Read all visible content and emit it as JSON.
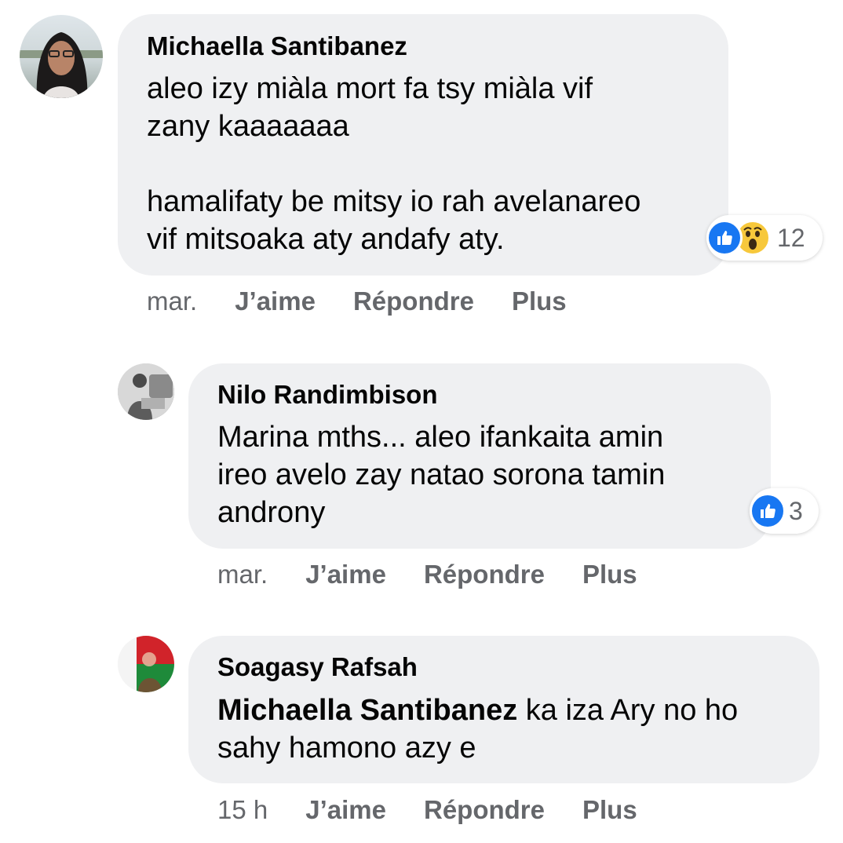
{
  "comments": [
    {
      "author": "Michaella Santibanez",
      "text": "aleo izy miàla mort fa tsy miàla vif\nzany kaaaaaaa\n\nhamalifaty be mitsy io rah avelanareo\nvif mitsoaka aty andafy aty.",
      "reaction_count": "12",
      "reaction_icons": [
        "like-icon",
        "wow-icon"
      ],
      "time": "mar.",
      "like_label": "J’aime",
      "reply_label": "Répondre",
      "more_label": "Plus"
    },
    {
      "author": "Nilo Randimbison",
      "text": "Marina mths... aleo ifankaita amin\nireo avelo zay natao sorona tamin\nandrony",
      "reaction_count": "3",
      "reaction_icons": [
        "like-icon"
      ],
      "time": "mar.",
      "like_label": "J’aime",
      "reply_label": "Répondre",
      "more_label": "Plus"
    },
    {
      "author": "Soagasy Rafsah",
      "mention": "Michaella Santibanez",
      "text": " ka iza Ary no ho\nsahy hamono azy e",
      "time": "15 h",
      "like_label": "J’aime",
      "reply_label": "Répondre",
      "more_label": "Plus"
    }
  ],
  "colors": {
    "bubble": "#eff0f2",
    "secondary_text": "#65676b",
    "like_blue": "#1877f2",
    "wow_yellow": "#f7c83b"
  }
}
